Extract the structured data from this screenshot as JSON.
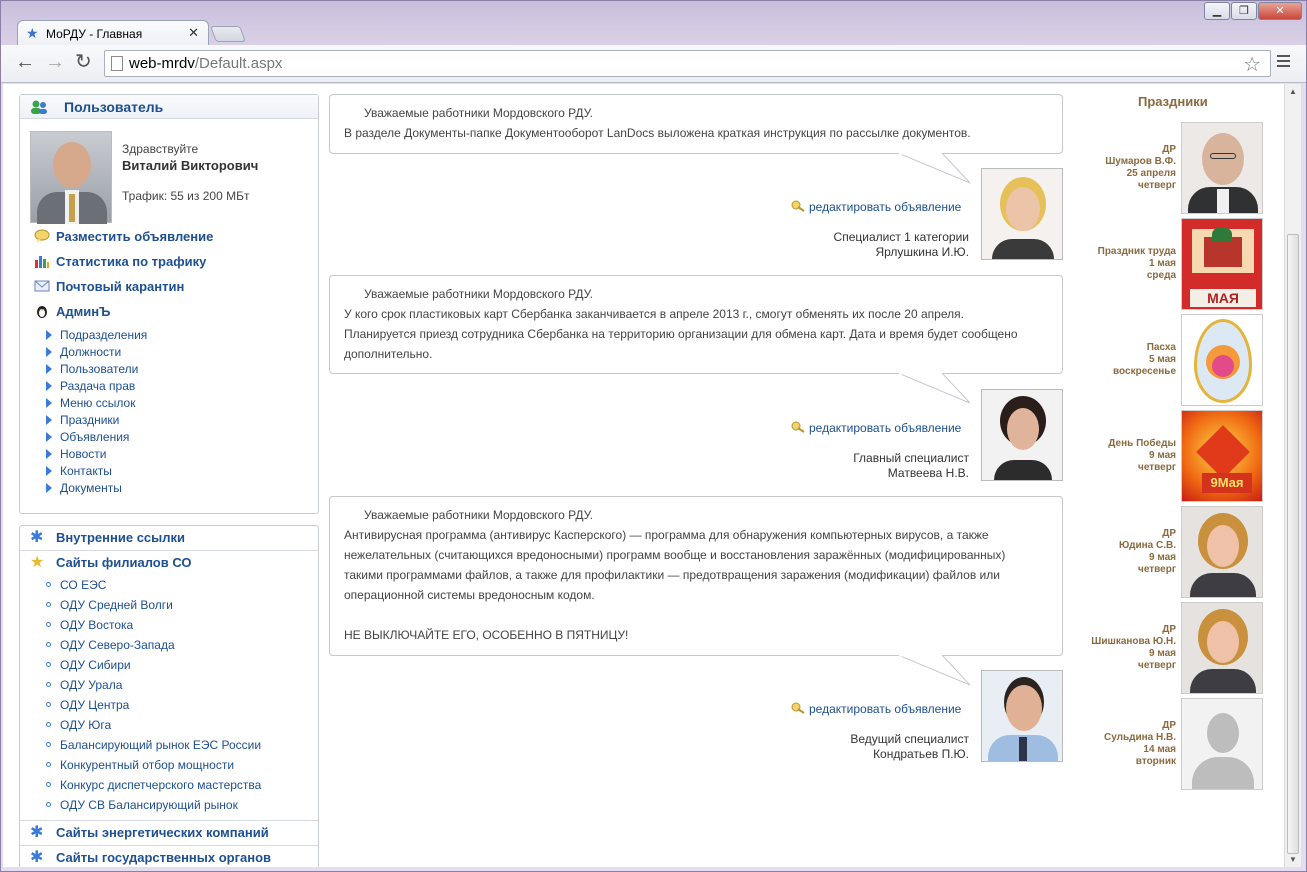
{
  "browser": {
    "tab_title": "МоРДУ - Главная",
    "url_host": "web-mrdv",
    "url_path": "/Default.aspx"
  },
  "user": {
    "header": "Пользователь",
    "greeting": "Здравствуйте",
    "name": "Виталий Викторович",
    "traffic": "Трафик: 55 из 200 МБт"
  },
  "actions": [
    "Разместить объявление",
    "Статистика по трафику",
    "Почтовый карантин",
    "АдминЪ"
  ],
  "admin_items": [
    "Подразделения",
    "Должности",
    "Пользователи",
    "Раздача прав",
    "Меню ссылок",
    "Праздники",
    "Объявления",
    "Новости",
    "Контакты",
    "Документы"
  ],
  "links": {
    "internal": "Внутренние ссылки",
    "branches": "Сайты филиалов СО",
    "energy": "Сайты энергетических компаний",
    "gov": "Сайты государственных органов",
    "branch_items": [
      "СО ЕЭС",
      "ОДУ Средней Волги",
      "ОДУ Востока",
      "ОДУ Северо-Запада",
      "ОДУ Сибири",
      "ОДУ Урала",
      "ОДУ Центра",
      "ОДУ Юга",
      "Балансирующий рынок ЕЭС России",
      "Конкурентный отбор мощности",
      "Конкурс диспетчерского мастерства",
      "ОДУ СВ Балансирующий рынок"
    ]
  },
  "announcements": [
    {
      "heading": "Уважаемые работники Мордовского РДУ.",
      "lines": [
        "В разделе Документы-папке Документооборот LanDocs выложена краткая инструкция по рассылке документов."
      ],
      "edit": "редактировать объявление",
      "position": "Специалист 1 категории",
      "author": "Ярлушкина И.Ю."
    },
    {
      "heading": "Уважаемые работники Мордовского РДУ.",
      "lines": [
        "У кого срок пластиковых карт Сбербанка заканчивается в апреле 2013 г., смогут обменять их после 20 апреля.",
        "Планируется приезд сотрудника Сбербанка на территорию организации для обмена карт. Дата и время будет сообщено",
        "дополнительно."
      ],
      "edit": "редактировать объявление",
      "position": "Главный специалист",
      "author": "Матвеева Н.В."
    },
    {
      "heading": "Уважаемые работники Мордовского РДУ.",
      "lines": [
        "Антивирусная программа (антивирус Касперского) — программа для обнаружения компьютерных вирусов, а также",
        "нежелательных (считающихся вредоносными) программ вообще и восстановления заражённых (модифицированных)",
        "такими программами файлов, а также для профилактики — предотвращения заражения (модификации) файлов или",
        "операционной системы вредоносным кодом.",
        "",
        "НЕ ВЫКЛЮЧАЙТЕ ЕГО, ОСОБЕННО В ПЯТНИЦУ!"
      ],
      "edit": "редактировать объявление",
      "position": "Ведущий специалист",
      "author": "Кондратьев П.Ю."
    }
  ],
  "holidays_title": "Праздники",
  "holidays": [
    {
      "l1": "ДР",
      "l2": "Шумаров В.Ф.",
      "l3": "25 апреля",
      "l4": "четверг",
      "img": "portrait-man"
    },
    {
      "l1": "Праздник труда",
      "l2": "1 мая",
      "l3": "среда",
      "l4": "",
      "img": "may-day"
    },
    {
      "l1": "Пасха",
      "l2": "5 мая",
      "l3": "воскресенье",
      "l4": "",
      "img": "easter-egg"
    },
    {
      "l1": "День Победы",
      "l2": "9 мая",
      "l3": "четверг",
      "l4": "",
      "img": "victory-day"
    },
    {
      "l1": "ДР",
      "l2": "Юдина С.В.",
      "l3": "9 мая",
      "l4": "четверг",
      "img": "portrait-woman"
    },
    {
      "l1": "ДР",
      "l2": "Шишканова Ю.Н.",
      "l3": "9 мая",
      "l4": "четверг",
      "img": "portrait-woman"
    },
    {
      "l1": "ДР",
      "l2": "Сульдина Н.В.",
      "l3": "14 мая",
      "l4": "вторник",
      "img": "no-photo"
    }
  ]
}
